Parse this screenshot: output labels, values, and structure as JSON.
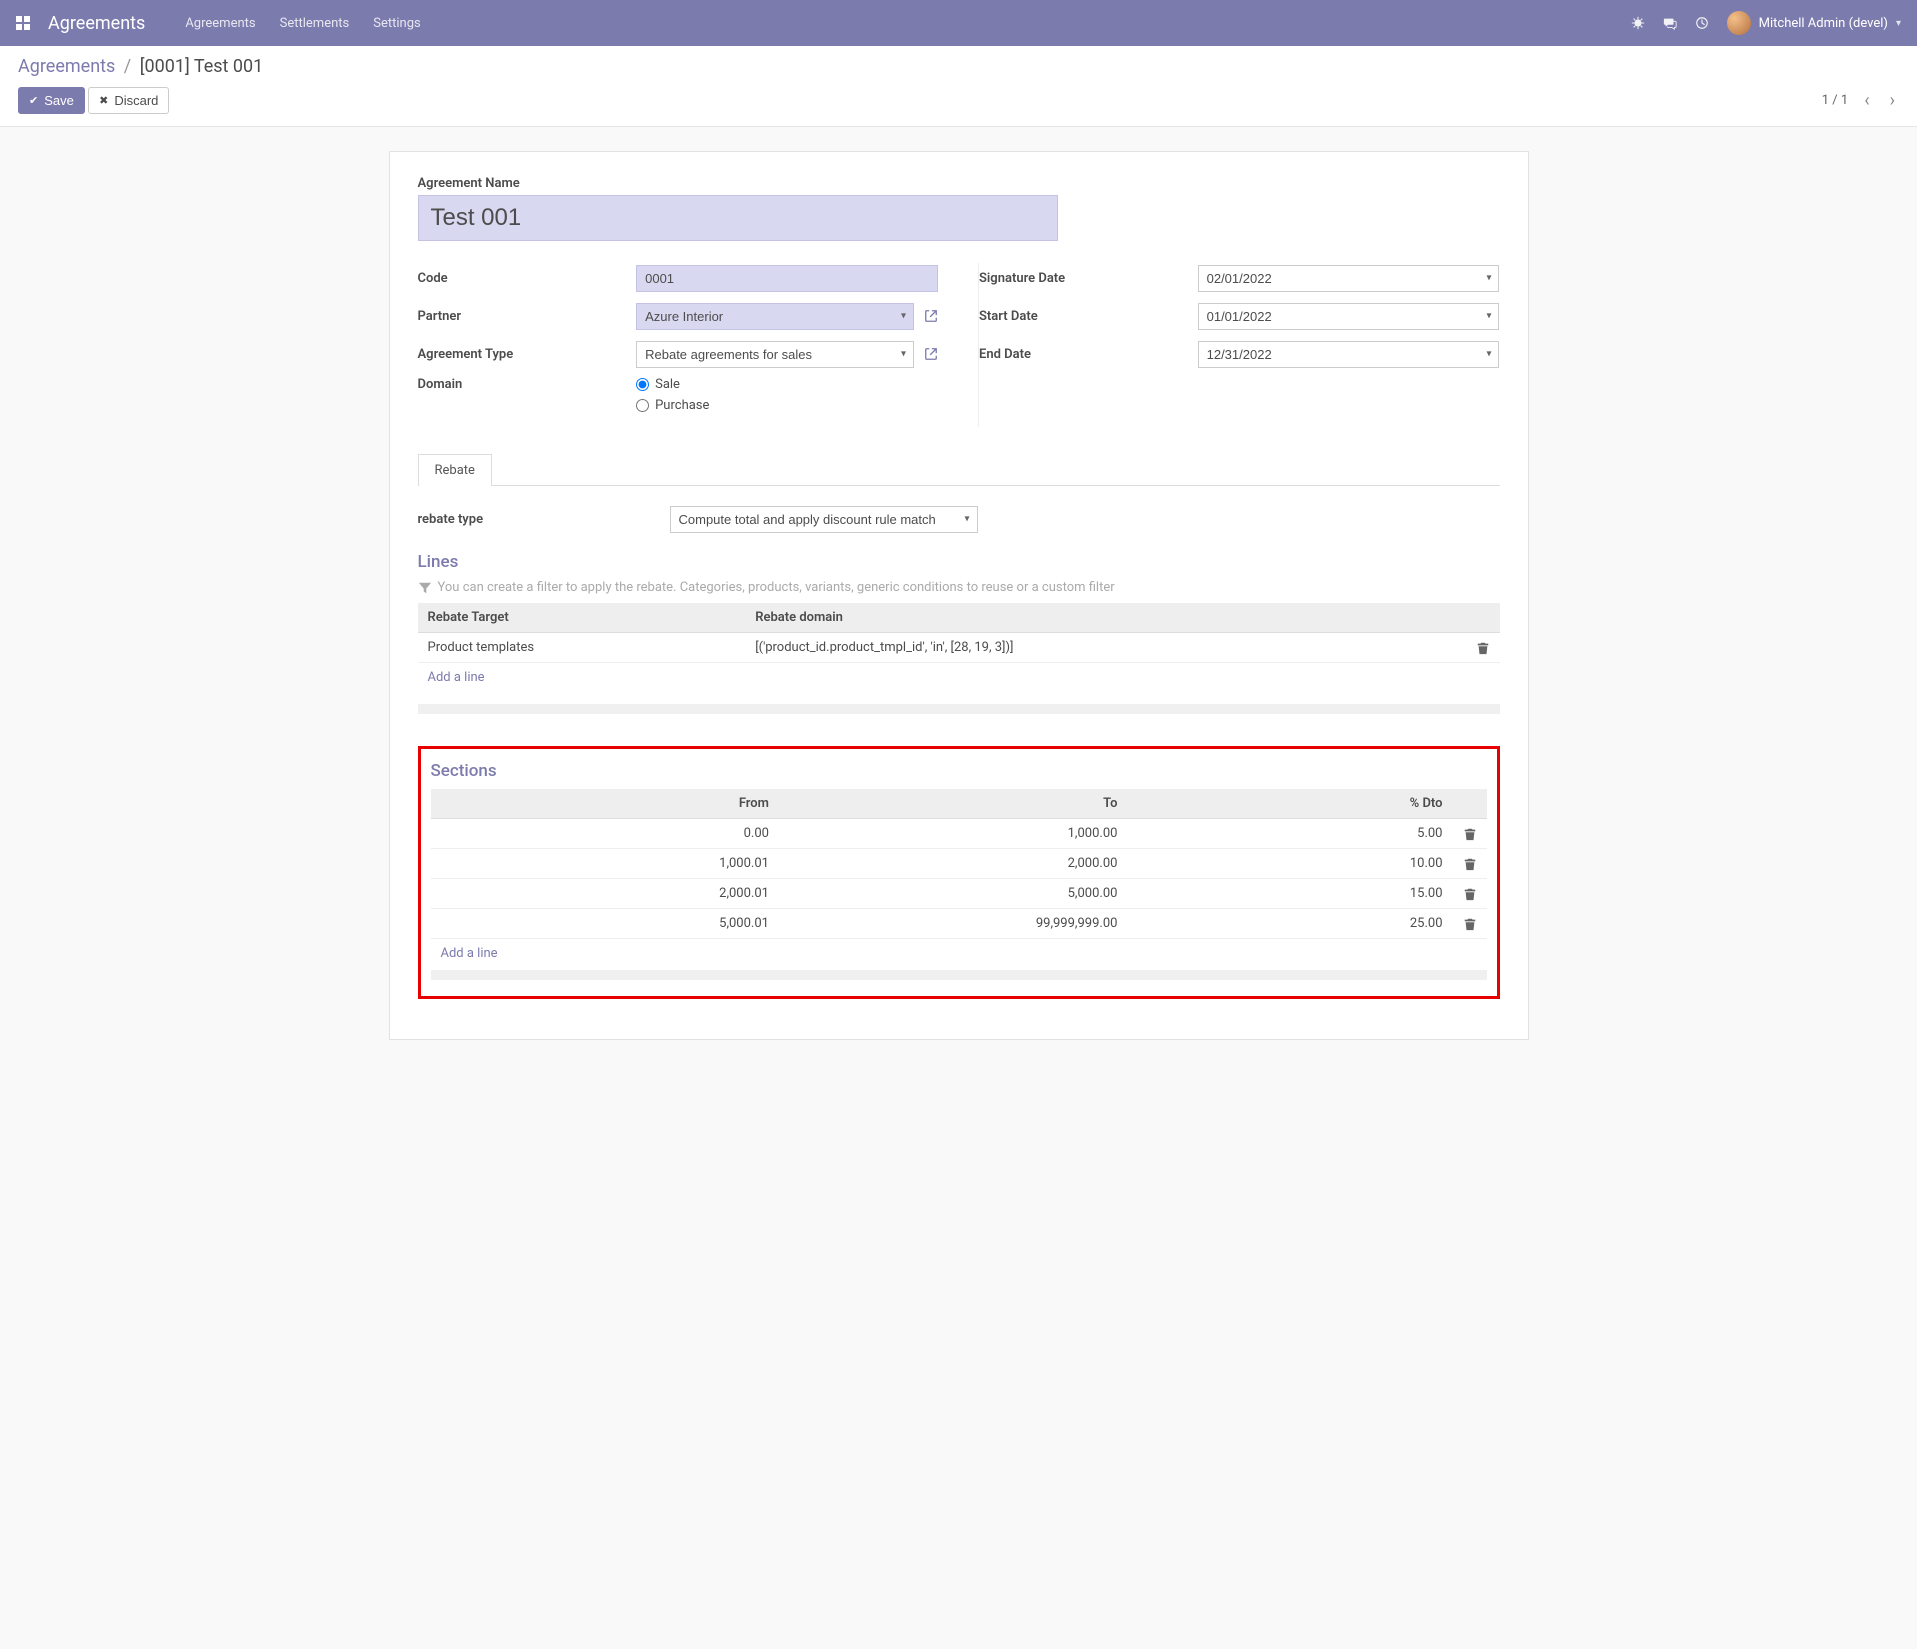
{
  "navbar": {
    "brand": "Agreements",
    "links": [
      "Agreements",
      "Settlements",
      "Settings"
    ],
    "user": "Mitchell Admin (devel)"
  },
  "breadcrumb": {
    "root": "Agreements",
    "current": "[0001] Test 001"
  },
  "actions": {
    "save": "Save",
    "discard": "Discard"
  },
  "pager": {
    "text": "1 / 1"
  },
  "form": {
    "name_label": "Agreement Name",
    "name_value": "Test 001",
    "code_label": "Code",
    "code_value": "0001",
    "partner_label": "Partner",
    "partner_value": "Azure Interior",
    "type_label": "Agreement Type",
    "type_value": "Rebate agreements for sales",
    "domain_label": "Domain",
    "domain_options": {
      "sale": "Sale",
      "purchase": "Purchase"
    },
    "sigdate_label": "Signature Date",
    "sigdate_value": "02/01/2022",
    "start_label": "Start Date",
    "start_value": "01/01/2022",
    "end_label": "End Date",
    "end_value": "12/31/2022"
  },
  "tabs": {
    "rebate": "Rebate"
  },
  "rebate": {
    "type_label": "rebate type",
    "type_value": "Compute total and apply discount rule match"
  },
  "lines": {
    "title": "Lines",
    "hint": "You can create a filter to apply the rebate. Categories, products, variants, generic conditions to reuse or a custom filter",
    "headers": {
      "target": "Rebate Target",
      "domain": "Rebate domain"
    },
    "rows": [
      {
        "target": "Product templates",
        "domain": "[('product_id.product_tmpl_id', 'in', [28, 19, 3])]"
      }
    ],
    "add": "Add a line"
  },
  "sections": {
    "title": "Sections",
    "headers": {
      "from": "From",
      "to": "To",
      "pct": "% Dto"
    },
    "rows": [
      {
        "from": "0.00",
        "to": "1,000.00",
        "pct": "5.00"
      },
      {
        "from": "1,000.01",
        "to": "2,000.00",
        "pct": "10.00"
      },
      {
        "from": "2,000.01",
        "to": "5,000.00",
        "pct": "15.00"
      },
      {
        "from": "5,000.01",
        "to": "99,999,999.00",
        "pct": "25.00"
      }
    ],
    "add": "Add a line"
  }
}
